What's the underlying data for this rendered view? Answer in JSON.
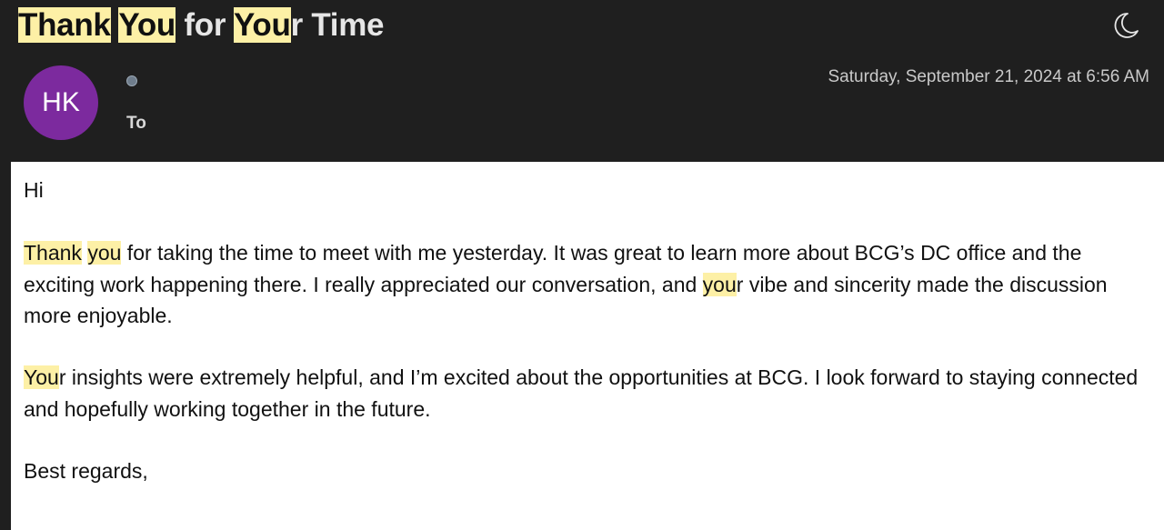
{
  "email": {
    "subject_parts": [
      {
        "text": "Thank",
        "highlight": true
      },
      {
        "text": " ",
        "highlight": false
      },
      {
        "text": "You",
        "highlight": true
      },
      {
        "text": " for ",
        "highlight": false
      },
      {
        "text": "You",
        "highlight": true
      },
      {
        "text": "r Time",
        "highlight": false
      }
    ],
    "sender": {
      "initials": "HK",
      "avatar_color": "#7c2a9e"
    },
    "to_label": "To",
    "date": "Saturday, September 21, 2024 at 6:56 AM",
    "appearance_icon": "moon-icon",
    "highlight_color": "#fdf0a6",
    "body": {
      "greeting": "Hi",
      "p1": [
        {
          "text": "Thank",
          "highlight": true
        },
        {
          "text": " ",
          "highlight": false
        },
        {
          "text": "you",
          "highlight": true
        },
        {
          "text": " for taking the time to meet with me yesterday. It was great to learn more about BCG’s DC office and the exciting work happening there. I really appreciated our conversation, and ",
          "highlight": false
        },
        {
          "text": "you",
          "highlight": true
        },
        {
          "text": "r vibe and sincerity made the discussion more enjoyable.",
          "highlight": false
        }
      ],
      "p2": [
        {
          "text": "You",
          "highlight": true
        },
        {
          "text": "r insights were extremely helpful, and I’m excited about the opportunities at BCG. I look forward to staying connected and hopefully working together in the future.",
          "highlight": false
        }
      ],
      "closing": "Best regards,"
    }
  }
}
